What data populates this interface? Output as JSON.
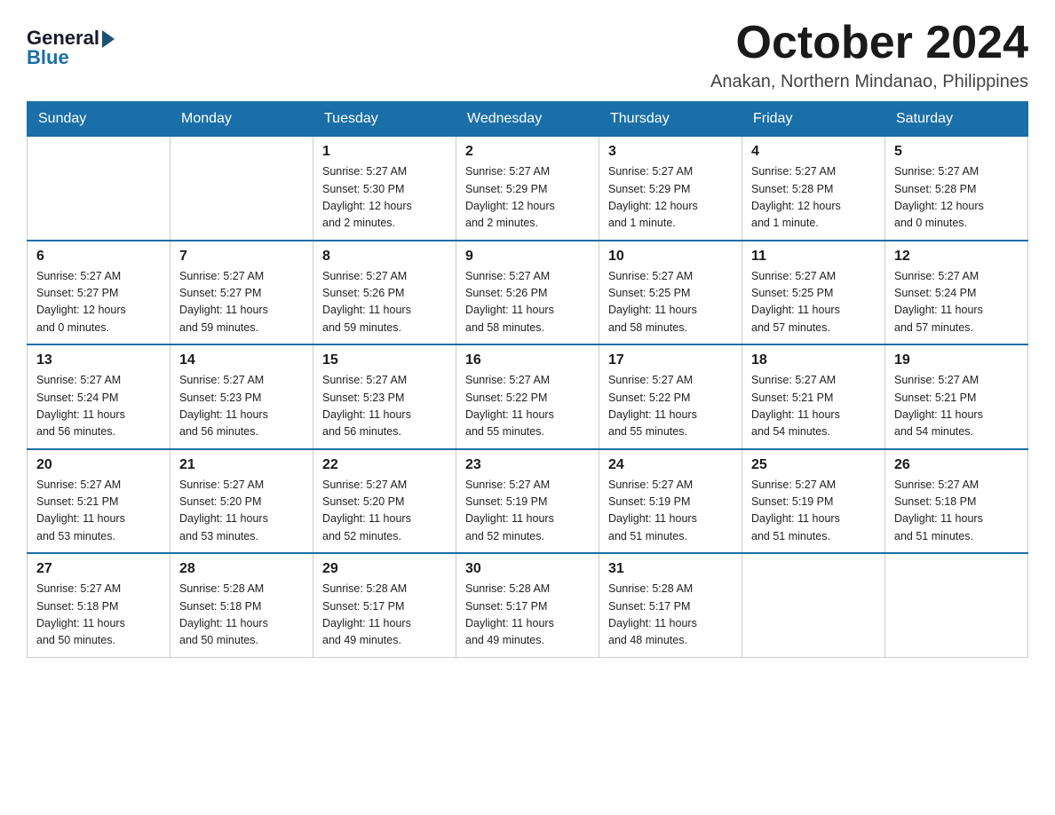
{
  "header": {
    "logo_general": "General",
    "logo_blue": "Blue",
    "month_title": "October 2024",
    "location": "Anakan, Northern Mindanao, Philippines"
  },
  "calendar": {
    "days_of_week": [
      "Sunday",
      "Monday",
      "Tuesday",
      "Wednesday",
      "Thursday",
      "Friday",
      "Saturday"
    ],
    "weeks": [
      [
        {
          "day": "",
          "info": ""
        },
        {
          "day": "",
          "info": ""
        },
        {
          "day": "1",
          "info": "Sunrise: 5:27 AM\nSunset: 5:30 PM\nDaylight: 12 hours\nand 2 minutes."
        },
        {
          "day": "2",
          "info": "Sunrise: 5:27 AM\nSunset: 5:29 PM\nDaylight: 12 hours\nand 2 minutes."
        },
        {
          "day": "3",
          "info": "Sunrise: 5:27 AM\nSunset: 5:29 PM\nDaylight: 12 hours\nand 1 minute."
        },
        {
          "day": "4",
          "info": "Sunrise: 5:27 AM\nSunset: 5:28 PM\nDaylight: 12 hours\nand 1 minute."
        },
        {
          "day": "5",
          "info": "Sunrise: 5:27 AM\nSunset: 5:28 PM\nDaylight: 12 hours\nand 0 minutes."
        }
      ],
      [
        {
          "day": "6",
          "info": "Sunrise: 5:27 AM\nSunset: 5:27 PM\nDaylight: 12 hours\nand 0 minutes."
        },
        {
          "day": "7",
          "info": "Sunrise: 5:27 AM\nSunset: 5:27 PM\nDaylight: 11 hours\nand 59 minutes."
        },
        {
          "day": "8",
          "info": "Sunrise: 5:27 AM\nSunset: 5:26 PM\nDaylight: 11 hours\nand 59 minutes."
        },
        {
          "day": "9",
          "info": "Sunrise: 5:27 AM\nSunset: 5:26 PM\nDaylight: 11 hours\nand 58 minutes."
        },
        {
          "day": "10",
          "info": "Sunrise: 5:27 AM\nSunset: 5:25 PM\nDaylight: 11 hours\nand 58 minutes."
        },
        {
          "day": "11",
          "info": "Sunrise: 5:27 AM\nSunset: 5:25 PM\nDaylight: 11 hours\nand 57 minutes."
        },
        {
          "day": "12",
          "info": "Sunrise: 5:27 AM\nSunset: 5:24 PM\nDaylight: 11 hours\nand 57 minutes."
        }
      ],
      [
        {
          "day": "13",
          "info": "Sunrise: 5:27 AM\nSunset: 5:24 PM\nDaylight: 11 hours\nand 56 minutes."
        },
        {
          "day": "14",
          "info": "Sunrise: 5:27 AM\nSunset: 5:23 PM\nDaylight: 11 hours\nand 56 minutes."
        },
        {
          "day": "15",
          "info": "Sunrise: 5:27 AM\nSunset: 5:23 PM\nDaylight: 11 hours\nand 56 minutes."
        },
        {
          "day": "16",
          "info": "Sunrise: 5:27 AM\nSunset: 5:22 PM\nDaylight: 11 hours\nand 55 minutes."
        },
        {
          "day": "17",
          "info": "Sunrise: 5:27 AM\nSunset: 5:22 PM\nDaylight: 11 hours\nand 55 minutes."
        },
        {
          "day": "18",
          "info": "Sunrise: 5:27 AM\nSunset: 5:21 PM\nDaylight: 11 hours\nand 54 minutes."
        },
        {
          "day": "19",
          "info": "Sunrise: 5:27 AM\nSunset: 5:21 PM\nDaylight: 11 hours\nand 54 minutes."
        }
      ],
      [
        {
          "day": "20",
          "info": "Sunrise: 5:27 AM\nSunset: 5:21 PM\nDaylight: 11 hours\nand 53 minutes."
        },
        {
          "day": "21",
          "info": "Sunrise: 5:27 AM\nSunset: 5:20 PM\nDaylight: 11 hours\nand 53 minutes."
        },
        {
          "day": "22",
          "info": "Sunrise: 5:27 AM\nSunset: 5:20 PM\nDaylight: 11 hours\nand 52 minutes."
        },
        {
          "day": "23",
          "info": "Sunrise: 5:27 AM\nSunset: 5:19 PM\nDaylight: 11 hours\nand 52 minutes."
        },
        {
          "day": "24",
          "info": "Sunrise: 5:27 AM\nSunset: 5:19 PM\nDaylight: 11 hours\nand 51 minutes."
        },
        {
          "day": "25",
          "info": "Sunrise: 5:27 AM\nSunset: 5:19 PM\nDaylight: 11 hours\nand 51 minutes."
        },
        {
          "day": "26",
          "info": "Sunrise: 5:27 AM\nSunset: 5:18 PM\nDaylight: 11 hours\nand 51 minutes."
        }
      ],
      [
        {
          "day": "27",
          "info": "Sunrise: 5:27 AM\nSunset: 5:18 PM\nDaylight: 11 hours\nand 50 minutes."
        },
        {
          "day": "28",
          "info": "Sunrise: 5:28 AM\nSunset: 5:18 PM\nDaylight: 11 hours\nand 50 minutes."
        },
        {
          "day": "29",
          "info": "Sunrise: 5:28 AM\nSunset: 5:17 PM\nDaylight: 11 hours\nand 49 minutes."
        },
        {
          "day": "30",
          "info": "Sunrise: 5:28 AM\nSunset: 5:17 PM\nDaylight: 11 hours\nand 49 minutes."
        },
        {
          "day": "31",
          "info": "Sunrise: 5:28 AM\nSunset: 5:17 PM\nDaylight: 11 hours\nand 48 minutes."
        },
        {
          "day": "",
          "info": ""
        },
        {
          "day": "",
          "info": ""
        }
      ]
    ]
  }
}
